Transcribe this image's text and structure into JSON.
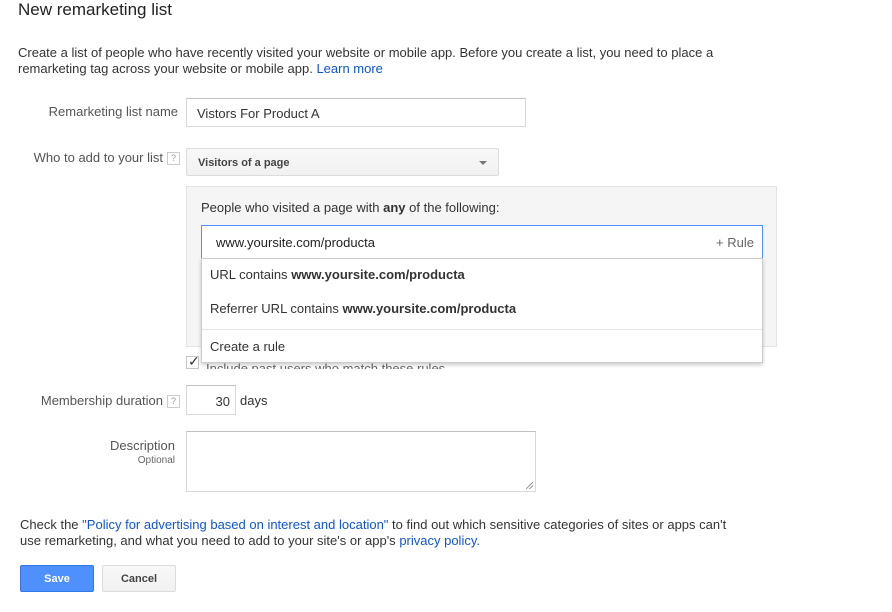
{
  "page": {
    "title": "New remarketing list",
    "intro_text": "Create a list of people who have recently visited your website or mobile app. Before you create a list, you need to place a remarketing tag across your website or mobile app.",
    "learn_more": "Learn more"
  },
  "form": {
    "list_name_label": "Remarketing list name",
    "list_name_value": "Vistors For Product A",
    "who_label": "Who to add to your list",
    "help_glyph": "?",
    "who_selected": "Visitors of a page",
    "rules": {
      "heading_prefix": "People who visited a page with",
      "heading_bold": "any",
      "heading_suffix": "of the following:",
      "input_value": "www.yoursite.com/producta",
      "add_rule": "+ Rule",
      "suggestions": [
        {
          "prefix": "URL contains",
          "value": "www.yoursite.com/producta"
        },
        {
          "prefix": "Referrer URL contains",
          "value": "www.yoursite.com/producta"
        }
      ],
      "create_rule": "Create a rule"
    },
    "include_past_users": "Include past users who match these rules",
    "duration_label": "Membership duration",
    "duration_value": "30",
    "duration_unit": "days",
    "description_label": "Description",
    "description_optional": "Optional",
    "description_value": ""
  },
  "policy": {
    "prefix": "Check the",
    "policy_link": "\"Policy for advertising based on interest and location\"",
    "middle": "to find out which sensitive categories of sites or apps can't use remarketing, and what you need to add to your site's or app's",
    "privacy_link": "privacy policy."
  },
  "actions": {
    "save": "Save",
    "cancel": "Cancel"
  },
  "colors": {
    "primary_button": "#4d90fe",
    "link": "#1155cc",
    "focus_border": "#4d90fe"
  }
}
